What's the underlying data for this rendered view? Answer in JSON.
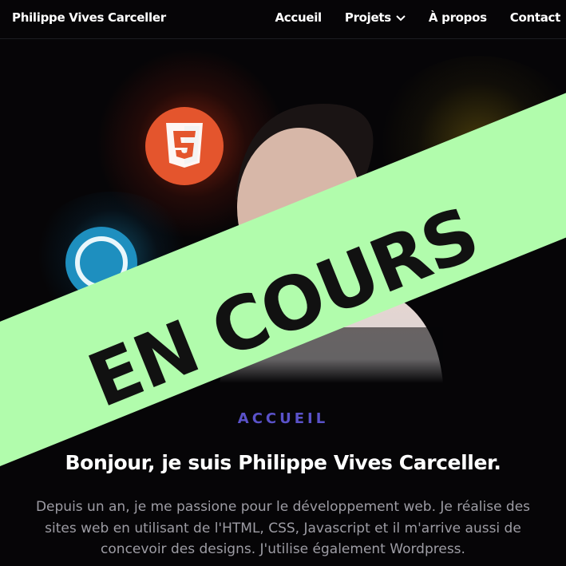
{
  "header": {
    "brand": "Philippe Vives Carceller",
    "nav": [
      "Accueil",
      "Projets",
      "À propos",
      "Contact"
    ]
  },
  "hero": {
    "banner_text": "EN COURS",
    "banner_color": "#b1fcac",
    "icons": [
      "html5-logo",
      "css3-logo"
    ]
  },
  "main": {
    "section_label": "ACCUEIL",
    "headline": "Bonjour, je suis Philippe Vives Carceller.",
    "intro": "Depuis un an, je me passione pour le développement web. Je réalise des sites web en utilisant de l'HTML, CSS, Javascript et il m'arrive aussi de concevoir des designs. J'utilise également Wordpress."
  },
  "colors": {
    "background": "#060507",
    "accent": "#5a52c9",
    "html5": "#e4552d",
    "css": "#1e8fbf"
  }
}
